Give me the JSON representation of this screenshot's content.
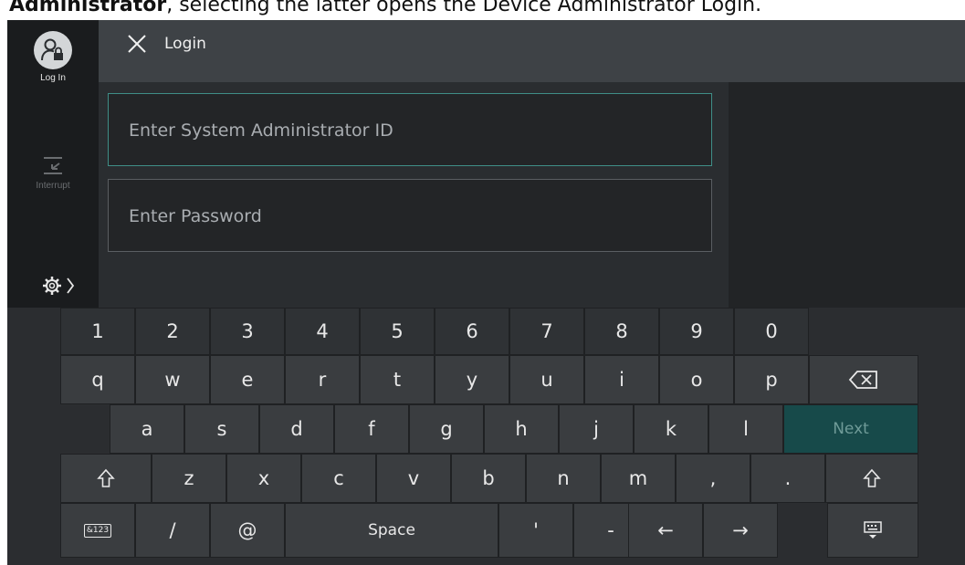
{
  "caption": {
    "bold": "Administrator",
    "rest": ", selecting the latter opens the Device Administrator Login."
  },
  "sidebar": {
    "login_label": "Log In",
    "interrupt_label": "Interrupt"
  },
  "header": {
    "title": "Login"
  },
  "form": {
    "admin_id_placeholder": "Enter System Administrator ID",
    "password_placeholder": "Enter Password"
  },
  "keyboard": {
    "numbers": [
      "1",
      "2",
      "3",
      "4",
      "5",
      "6",
      "7",
      "8",
      "9",
      "0"
    ],
    "row_q": [
      "q",
      "w",
      "e",
      "r",
      "t",
      "y",
      "u",
      "i",
      "o",
      "p"
    ],
    "row_a": [
      "a",
      "s",
      "d",
      "f",
      "g",
      "h",
      "j",
      "k",
      "l"
    ],
    "next_label": "Next",
    "row_z": [
      "z",
      "x",
      "c",
      "v",
      "b",
      "n",
      "m",
      ",",
      "."
    ],
    "bottom": {
      "mode_label": "&123",
      "slash": "/",
      "at": "@",
      "space_label": "Space",
      "apostrophe": "'",
      "dash": "-",
      "left_arrow": "←",
      "right_arrow": "→"
    }
  },
  "colors": {
    "focus_border": "#3f8e87",
    "next_key": "#174a4a"
  }
}
